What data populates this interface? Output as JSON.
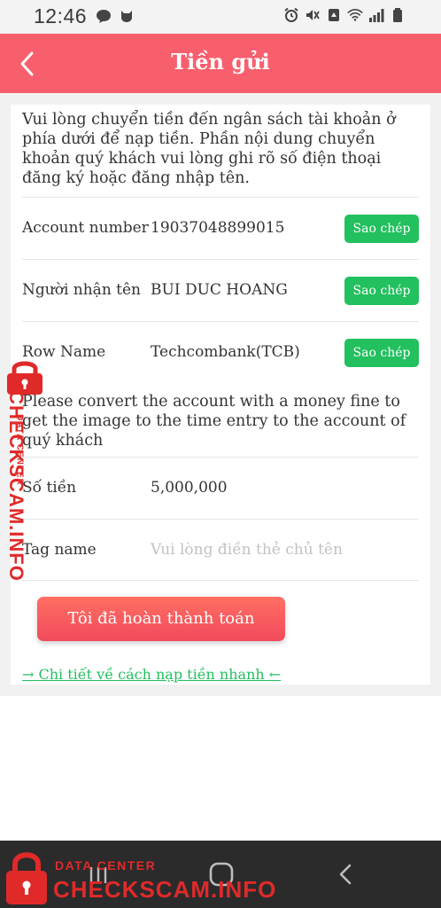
{
  "status_bar": {
    "time": "12:46",
    "left_icons": [
      "chat-bubble-icon",
      "cat-notification-icon"
    ],
    "right_icons": [
      "alarm-icon",
      "mute-icon",
      "recycle-icon",
      "wifi-icon",
      "signal-icon",
      "battery-icon"
    ]
  },
  "header": {
    "title": "Tiền gửi",
    "back_icon": "chevron-left-icon",
    "background": "#f85f6d"
  },
  "intro_text": "Vui lòng chuyển tiền đến ngân sách tài khoản ở phía dưới để nạp tiền. Phần nội dung chuyển khoản quý khách vui lòng ghi rõ số điện thoại đăng ký hoặc đăng nhập tên.",
  "account_rows": [
    {
      "label": "Account number",
      "value": "19037048899015",
      "copy_label": "Sao chép"
    },
    {
      "label": "Người nhận tên",
      "value": "BUI DUC HOANG",
      "copy_label": "Sao chép"
    },
    {
      "label": "Row Name",
      "value": "Techcombank(TCB)",
      "copy_label": "Sao chép"
    }
  ],
  "convert_note": "Please convert the account with a money fine to get the image to the time entry to the account of quý khách",
  "amount_row": {
    "label": "Số tiền",
    "value": "5,000,000"
  },
  "tag_row": {
    "label": "Tag name",
    "placeholder": "Vui lòng điền thẻ chủ tên"
  },
  "submit_button": {
    "label": "Tôi đã hoàn thành toán"
  },
  "guide_link": {
    "label": "→ Chi tiết về cách nạp tiền nhanh ←"
  },
  "nav_bar": {
    "icons": [
      "recent-apps-icon",
      "home-icon",
      "back-icon"
    ]
  },
  "watermark": {
    "main_text": "CHECKSCAM.INFO",
    "sub_text": "DATA CENTER",
    "color": "#e02a2a"
  },
  "colors": {
    "accent_green": "#22c05e",
    "button_red": "#f14a5c"
  }
}
